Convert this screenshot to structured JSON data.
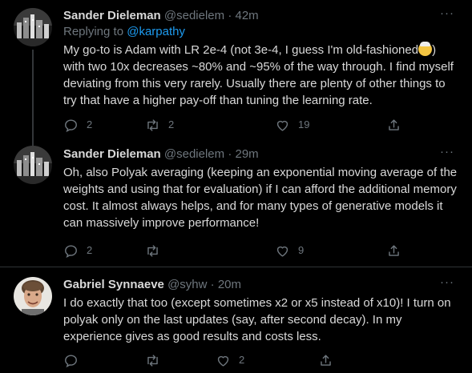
{
  "tweets": [
    {
      "name": "Sander Dieleman",
      "handle": "@sedielem",
      "separator": "·",
      "time": "42m",
      "reply_prefix": "Replying to ",
      "reply_to": "@karpathy",
      "text_a": "My go-to is Adam with LR 2e-4 (not 3e-4, I guess I'm old-fashioned",
      "emoji": "older-person-emoji",
      "text_b": ") with two 10x decreases ~80% and ~95% of the way through. I find myself deviating from this very rarely. Usually there are plenty of other things to try that have a higher pay-off than tuning the learning rate.",
      "replies": "2",
      "retweets": "2",
      "likes": "19"
    },
    {
      "name": "Sander Dieleman",
      "handle": "@sedielem",
      "separator": "·",
      "time": "29m",
      "text": "Oh, also Polyak averaging (keeping an exponential moving average of the weights and using that for evaluation) if I can afford the additional memory cost. It almost always helps, and for many types of generative models it can massively improve performance!",
      "replies": "2",
      "retweets": "",
      "likes": "9"
    },
    {
      "name": "Gabriel Synnaeve",
      "handle": "@syhw",
      "separator": "·",
      "time": "20m",
      "text": "I do exactly that too (except sometimes x2 or x5 instead of x10)! I turn on polyak only on the last updates (say, after second decay). In my experience gives as good results and costs less.",
      "replies": "",
      "retweets": "",
      "likes": "2"
    }
  ],
  "more_label": "···",
  "icons": {
    "reply": "reply-icon",
    "retweet": "retweet-icon",
    "like": "heart-icon",
    "share": "share-icon"
  },
  "colors": {
    "background": "#000000",
    "text": "#D9D9D9",
    "muted": "#6E767D",
    "link": "#1D9BF0",
    "divider": "#2F3336"
  }
}
